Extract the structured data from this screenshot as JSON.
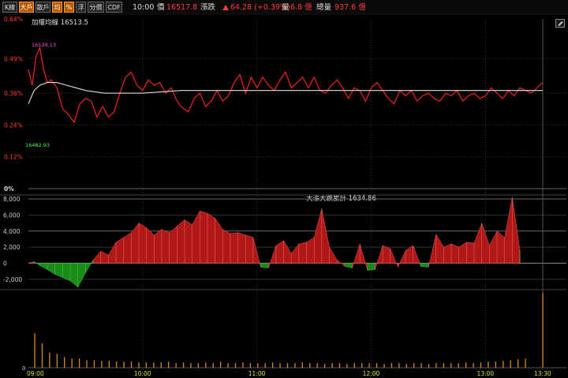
{
  "toolbar": {
    "buttons": [
      {
        "label": "K線",
        "active": false
      },
      {
        "label": "大戶",
        "active": true
      },
      {
        "label": "散戶",
        "active": false
      },
      {
        "label": "均",
        "active": true
      },
      {
        "label": "%",
        "active": true
      },
      {
        "label": "浮",
        "active": false
      },
      {
        "label": "分價",
        "active": false
      },
      {
        "label": "CDF",
        "active": false
      }
    ]
  },
  "status": {
    "time": "10:00",
    "price_label": "價",
    "price": "16517.8",
    "change_label": "漲跌",
    "change": "64.28 (+0.39%)",
    "volume_label": "量",
    "volume": "6.8 億",
    "total_label": "總量",
    "total": "937.6 億"
  },
  "main": {
    "avg_label": "加權均線 16513.5",
    "high_label": "16539.13",
    "low_label": "16482.93",
    "y_ticks": [
      "0.64%",
      "0.49%",
      "0.36%",
      "0.24%",
      "0.12%",
      "0%"
    ]
  },
  "sub": {
    "title": "大漲大跌累計 1634.86",
    "y_ticks": [
      "8,000",
      "6,000",
      "4,000",
      "2,000",
      "0",
      "-2,000"
    ]
  },
  "volume": {
    "zero_label": "0"
  },
  "time_labels": [
    "09:00",
    "10:00",
    "11:00",
    "12:00",
    "13:00",
    "13:30"
  ],
  "colors": {
    "up": "#e02020",
    "down": "#22aa22",
    "avg": "#dddddd",
    "volume": "#d98a1a",
    "grid": "#333333"
  },
  "chart_data": [
    {
      "type": "line",
      "title": "加權均線 16513.5",
      "y_unit": "%",
      "ylim": [
        0,
        0.64
      ],
      "x_range": [
        "09:00",
        "13:30"
      ],
      "series": [
        {
          "name": "",
          "color": "#e02020",
          "x": [
            0,
            2,
            4,
            6,
            8,
            10,
            12,
            15,
            18,
            21,
            24,
            27,
            30,
            33,
            36,
            39,
            42,
            45,
            48,
            51,
            54,
            57,
            60,
            63,
            66,
            69,
            72,
            75,
            78,
            80,
            84,
            87,
            90,
            93,
            96,
            99,
            102,
            105,
            108,
            111,
            114,
            117,
            120,
            123,
            126,
            129,
            132,
            135,
            138,
            141,
            144,
            147,
            150,
            153,
            156,
            159,
            162,
            165,
            168,
            171,
            174,
            177,
            180,
            183,
            186,
            189,
            192,
            195,
            198,
            201,
            204,
            207,
            210,
            213,
            216,
            219,
            222,
            225,
            228,
            231,
            234,
            237,
            240,
            243,
            246,
            249,
            252,
            255,
            258,
            261,
            264,
            267,
            270
          ],
          "y": [
            0.45,
            0.39,
            0.5,
            0.53,
            0.45,
            0.4,
            0.41,
            0.38,
            0.3,
            0.28,
            0.25,
            0.32,
            0.34,
            0.33,
            0.27,
            0.31,
            0.27,
            0.29,
            0.36,
            0.42,
            0.44,
            0.39,
            0.37,
            0.41,
            0.39,
            0.4,
            0.36,
            0.38,
            0.33,
            0.31,
            0.29,
            0.34,
            0.36,
            0.31,
            0.33,
            0.37,
            0.33,
            0.35,
            0.4,
            0.43,
            0.36,
            0.42,
            0.38,
            0.42,
            0.39,
            0.37,
            0.41,
            0.44,
            0.38,
            0.4,
            0.42,
            0.38,
            0.42,
            0.37,
            0.36,
            0.39,
            0.41,
            0.38,
            0.34,
            0.38,
            0.37,
            0.33,
            0.38,
            0.4,
            0.37,
            0.34,
            0.32,
            0.37,
            0.35,
            0.37,
            0.33,
            0.35,
            0.36,
            0.34,
            0.33,
            0.36,
            0.35,
            0.37,
            0.33,
            0.35,
            0.36,
            0.34,
            0.35,
            0.38,
            0.36,
            0.34,
            0.37,
            0.35,
            0.38,
            0.37,
            0.36,
            0.38,
            0.4
          ]
        },
        {
          "name": "",
          "color": "#dddddd",
          "x": [
            0,
            3,
            6,
            10,
            15,
            20,
            25,
            30,
            40,
            50,
            60,
            80,
            100,
            120,
            150,
            180,
            210,
            240,
            270
          ],
          "y": [
            0.32,
            0.37,
            0.39,
            0.4,
            0.4,
            0.39,
            0.38,
            0.37,
            0.36,
            0.36,
            0.36,
            0.37,
            0.37,
            0.37,
            0.37,
            0.37,
            0.37,
            0.37,
            0.37
          ]
        }
      ]
    },
    {
      "type": "area",
      "title": "大漲大跌累計 1634.86",
      "ylim": [
        -3000,
        8500
      ],
      "x_range": [
        "09:00",
        "13:30"
      ],
      "x": [
        0,
        3,
        6,
        10,
        14,
        18,
        22,
        26,
        30,
        34,
        38,
        42,
        46,
        50,
        54,
        58,
        62,
        66,
        70,
        74,
        78,
        82,
        86,
        90,
        94,
        98,
        102,
        106,
        110,
        114,
        118,
        122,
        126,
        130,
        134,
        138,
        142,
        146,
        150,
        154,
        158,
        162,
        166,
        170,
        174,
        178,
        182,
        186,
        190,
        194,
        198,
        202,
        206,
        210,
        214,
        218,
        222,
        226,
        230,
        234,
        238,
        242,
        246,
        250,
        254,
        258,
        262,
        266,
        270
      ],
      "values": [
        0,
        200,
        -300,
        -800,
        -1400,
        -1800,
        -2200,
        -3000,
        -1200,
        400,
        1500,
        1000,
        2600,
        3200,
        3800,
        5000,
        4400,
        3500,
        4200,
        3800,
        4600,
        5400,
        4800,
        6500,
        6200,
        5600,
        4200,
        3700,
        3800,
        3500,
        3200,
        -500,
        -600,
        2200,
        2800,
        1200,
        2400,
        2600,
        3200,
        6800,
        2000,
        400,
        -400,
        -600,
        2400,
        -900,
        -800,
        2200,
        1800,
        -500,
        1600,
        2200,
        -400,
        -500,
        3600,
        2000,
        2400,
        2000,
        2600,
        2500,
        5000,
        2200,
        4000,
        3200,
        8200,
        1634
      ]
    },
    {
      "type": "bar",
      "title": "",
      "x_range": [
        "09:00",
        "13:30"
      ],
      "values": [
        45,
        32,
        20,
        18,
        14,
        12,
        12,
        10,
        10,
        9,
        9,
        8,
        8,
        8,
        7,
        7,
        7,
        7,
        8,
        6,
        7,
        6,
        6,
        7,
        6,
        8,
        6,
        6,
        7,
        6,
        6,
        6,
        7,
        6,
        6,
        6,
        7,
        6,
        6,
        5,
        6,
        6,
        5,
        6,
        6,
        6,
        6,
        5,
        6,
        6,
        5,
        6,
        6,
        5,
        6,
        6,
        6,
        6,
        7,
        6,
        7,
        8,
        8,
        9,
        10,
        11,
        12,
        98
      ]
    }
  ]
}
